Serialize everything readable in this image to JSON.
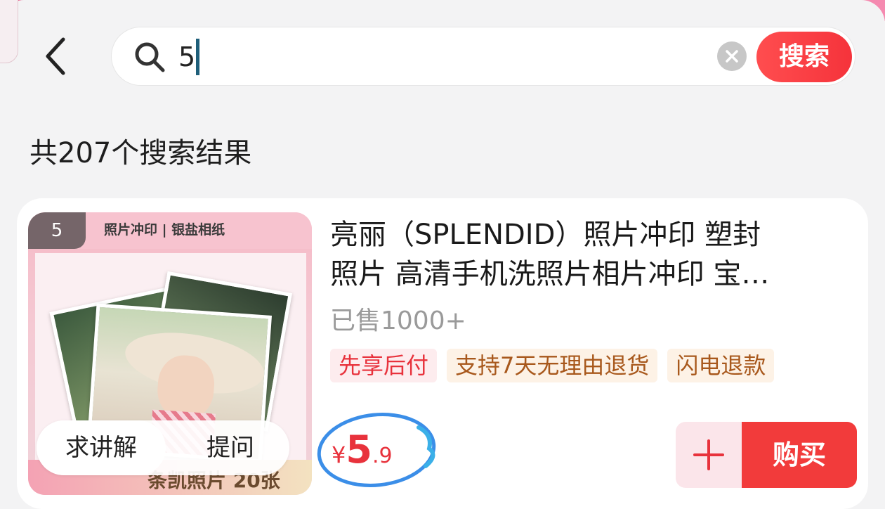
{
  "search": {
    "query": "5",
    "button_label": "搜索"
  },
  "results": {
    "count_text": "共207个搜索结果"
  },
  "product": {
    "thumb_badge": "5",
    "thumb_title": "照片冲印 | 银盐相纸",
    "thumb_footer": "条凯照片 20张",
    "title_line1": "亮丽（SPLENDID）照片冲印  塑封",
    "title_line2": "照片 高清手机洗照片相片冲印 宝…",
    "sold": "已售1000+",
    "tags": [
      "先享后付",
      "支持7天无理由退货",
      "闪电退款"
    ],
    "price": {
      "currency": "¥",
      "integer": "5",
      "decimal": ".9"
    },
    "ask_explain": "求讲解",
    "ask_question": "提问",
    "buy_label": "购买"
  },
  "colors": {
    "accent_red": "#f23b3b",
    "ring_blue": "#3b8ee8"
  }
}
